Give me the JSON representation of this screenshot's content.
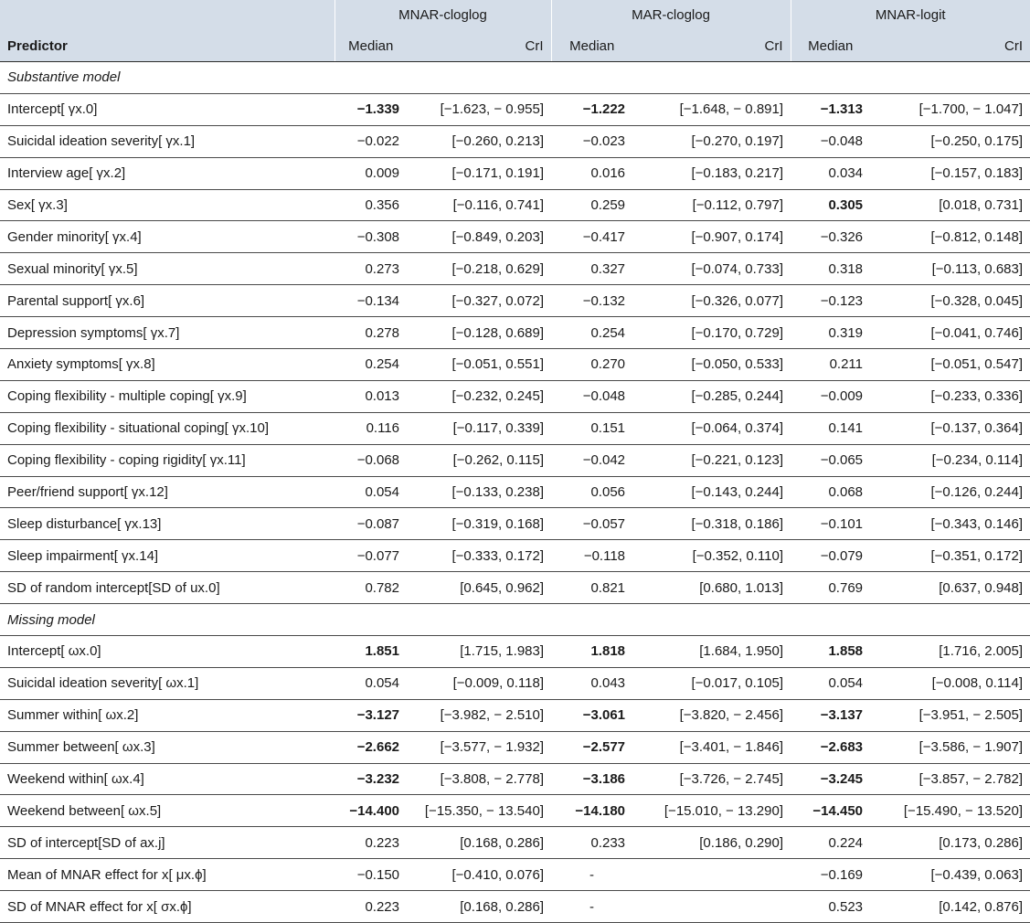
{
  "header": {
    "groups": [
      "MNAR-cloglog",
      "MAR-cloglog",
      "MNAR-logit"
    ],
    "predictor_label": "Predictor",
    "median_label": "Median",
    "cri_label": "CrI"
  },
  "sections": [
    {
      "title": "Substantive model",
      "rows": [
        {
          "label": "Intercept[ γx.0]",
          "v": [
            [
              "−1.339",
              true,
              "[−1.623, − 0.955]"
            ],
            [
              "−1.222",
              true,
              "[−1.648, − 0.891]"
            ],
            [
              "−1.313",
              true,
              "[−1.700, − 1.047]"
            ]
          ],
          "offset": true
        },
        {
          "label": "Suicidal ideation severity[ γx.1]",
          "v": [
            [
              "−0.022",
              false,
              "[−0.260, 0.213]"
            ],
            [
              "−0.023",
              false,
              "[−0.270, 0.197]"
            ],
            [
              "−0.048",
              false,
              "[−0.250, 0.175]"
            ]
          ],
          "offset": true
        },
        {
          "label": "Interview age[ γx.2]",
          "v": [
            [
              "0.009",
              false,
              "[−0.171, 0.191]"
            ],
            [
              "0.016",
              false,
              "[−0.183, 0.217]"
            ],
            [
              "0.034",
              false,
              "[−0.157, 0.183]"
            ]
          ],
          "offset": true
        },
        {
          "label": "Sex[ γx.3]",
          "v": [
            [
              "0.356",
              false,
              "[−0.116, 0.741]"
            ],
            [
              "0.259",
              false,
              "[−0.112, 0.797]"
            ],
            [
              "0.305",
              true,
              "[0.018, 0.731]"
            ]
          ],
          "offset": true
        },
        {
          "label": "Gender minority[ γx.4]",
          "v": [
            [
              "−0.308",
              false,
              "[−0.849, 0.203]"
            ],
            [
              "−0.417",
              false,
              "[−0.907, 0.174]"
            ],
            [
              "−0.326",
              false,
              "[−0.812, 0.148]"
            ]
          ],
          "offset": true
        },
        {
          "label": "Sexual minority[ γx.5]",
          "v": [
            [
              "0.273",
              false,
              "[−0.218, 0.629]"
            ],
            [
              "0.327",
              false,
              "[−0.074, 0.733]"
            ],
            [
              "0.318",
              false,
              "[−0.113, 0.683]"
            ]
          ],
          "offset": true
        },
        {
          "label": "Parental support[ γx.6]",
          "v": [
            [
              "−0.134",
              false,
              "[−0.327, 0.072]"
            ],
            [
              "−0.132",
              false,
              "[−0.326, 0.077]"
            ],
            [
              "−0.123",
              false,
              "[−0.328, 0.045]"
            ]
          ],
          "offset": true
        },
        {
          "label": "Depression symptoms[ γx.7]",
          "v": [
            [
              "0.278",
              false,
              "[−0.128, 0.689]"
            ],
            [
              "0.254",
              false,
              "[−0.170, 0.729]"
            ],
            [
              "0.319",
              false,
              "[−0.041, 0.746]"
            ]
          ],
          "offset": true
        },
        {
          "label": "Anxiety symptoms[ γx.8]",
          "v": [
            [
              "0.254",
              false,
              "[−0.051, 0.551]"
            ],
            [
              "0.270",
              false,
              "[−0.050, 0.533]"
            ],
            [
              "0.211",
              false,
              "[−0.051, 0.547]"
            ]
          ],
          "offset": true
        },
        {
          "label": "Coping flexibility - multiple coping[ γx.9]",
          "v": [
            [
              "0.013",
              false,
              "[−0.232, 0.245]"
            ],
            [
              "−0.048",
              false,
              "[−0.285, 0.244]"
            ],
            [
              "−0.009",
              false,
              "[−0.233, 0.336]"
            ]
          ],
          "offset": true
        },
        {
          "label": "Coping flexibility - situational coping[ γx.10]",
          "v": [
            [
              "0.116",
              false,
              "[−0.117, 0.339]"
            ],
            [
              "0.151",
              false,
              "[−0.064, 0.374]"
            ],
            [
              "0.141",
              false,
              "[−0.137, 0.364]"
            ]
          ],
          "offset": true
        },
        {
          "label": "Coping flexibility - coping rigidity[ γx.11]",
          "v": [
            [
              "−0.068",
              false,
              "[−0.262, 0.115]"
            ],
            [
              "−0.042",
              false,
              "[−0.221, 0.123]"
            ],
            [
              "−0.065",
              false,
              "[−0.234, 0.114]"
            ]
          ],
          "offset": true
        },
        {
          "label": "Peer/friend support[ γx.12]",
          "v": [
            [
              "0.054",
              false,
              "[−0.133, 0.238]"
            ],
            [
              "0.056",
              false,
              "[−0.143, 0.244]"
            ],
            [
              "0.068",
              false,
              "[−0.126, 0.244]"
            ]
          ],
          "offset": true
        },
        {
          "label": "Sleep disturbance[ γx.13]",
          "v": [
            [
              "−0.087",
              false,
              "[−0.319, 0.168]"
            ],
            [
              "−0.057",
              false,
              "[−0.318, 0.186]"
            ],
            [
              "−0.101",
              false,
              "[−0.343, 0.146]"
            ]
          ],
          "offset": true
        },
        {
          "label": "Sleep impairment[ γx.14]",
          "v": [
            [
              "−0.077",
              false,
              "[−0.333, 0.172]"
            ],
            [
              "−0.118",
              false,
              "[−0.352, 0.110]"
            ],
            [
              "−0.079",
              false,
              "[−0.351, 0.172]"
            ]
          ],
          "offset": true
        },
        {
          "label": "SD of random intercept[SD of ux.0]",
          "v": [
            [
              "0.782",
              false,
              "[0.645, 0.962]"
            ],
            [
              "0.821",
              false,
              "[0.680, 1.013]"
            ],
            [
              "0.769",
              false,
              "[0.637, 0.948]"
            ]
          ],
          "offset": true
        }
      ]
    },
    {
      "title": "Missing model",
      "rows": [
        {
          "label": "Intercept[ ωx.0]",
          "v": [
            [
              "1.851",
              true,
              "[1.715, 1.983]"
            ],
            [
              "1.818",
              true,
              "[1.684, 1.950]"
            ],
            [
              "1.858",
              true,
              "[1.716, 2.005]"
            ]
          ],
          "offset": false
        },
        {
          "label": "Suicidal ideation severity[ ωx.1]",
          "v": [
            [
              "0.054",
              false,
              "[−0.009, 0.118]"
            ],
            [
              "0.043",
              false,
              "[−0.017, 0.105]"
            ],
            [
              "0.054",
              false,
              "[−0.008, 0.114]"
            ]
          ],
          "offset": false
        },
        {
          "label": "Summer within[ ωx.2]",
          "v": [
            [
              "−3.127",
              true,
              "[−3.982, − 2.510]"
            ],
            [
              "−3.061",
              true,
              "[−3.820, − 2.456]"
            ],
            [
              "−3.137",
              true,
              "[−3.951, − 2.505]"
            ]
          ],
          "offset": false
        },
        {
          "label": "Summer between[ ωx.3]",
          "v": [
            [
              "−2.662",
              true,
              "[−3.577, − 1.932]"
            ],
            [
              "−2.577",
              true,
              "[−3.401, − 1.846]"
            ],
            [
              "−2.683",
              true,
              "[−3.586, − 1.907]"
            ]
          ],
          "offset": false
        },
        {
          "label": "Weekend within[ ωx.4]",
          "v": [
            [
              "−3.232",
              true,
              "[−3.808, − 2.778]"
            ],
            [
              "−3.186",
              true,
              "[−3.726, − 2.745]"
            ],
            [
              "−3.245",
              true,
              "[−3.857, − 2.782]"
            ]
          ],
          "offset": false
        },
        {
          "label": "Weekend between[ ωx.5]",
          "v": [
            [
              "−14.400",
              true,
              "[−15.350, − 13.540]"
            ],
            [
              "−14.180",
              true,
              "[−15.010, − 13.290]"
            ],
            [
              "−14.450",
              true,
              "[−15.490, − 13.520]"
            ]
          ],
          "offset": false
        },
        {
          "label": "SD of intercept[SD of ax.j]",
          "v": [
            [
              "0.223",
              false,
              "[0.168, 0.286]"
            ],
            [
              "0.233",
              false,
              "[0.186, 0.290]"
            ],
            [
              "0.224",
              false,
              "[0.173, 0.286]"
            ]
          ],
          "offset": false
        },
        {
          "label": "Mean of MNAR effect for x[ μx.ϕ]",
          "v": [
            [
              "−0.150",
              false,
              "[−0.410, 0.076]"
            ],
            [
              "-",
              false,
              ""
            ],
            [
              "−0.169",
              false,
              "[−0.439, 0.063]"
            ]
          ],
          "offset": false
        },
        {
          "label": "SD of MNAR effect for x[ σx.ϕ]",
          "v": [
            [
              "0.223",
              false,
              "[0.168, 0.286]"
            ],
            [
              "-",
              false,
              ""
            ],
            [
              "0.523",
              false,
              "[0.142, 0.876]"
            ]
          ],
          "offset": false
        }
      ]
    }
  ]
}
